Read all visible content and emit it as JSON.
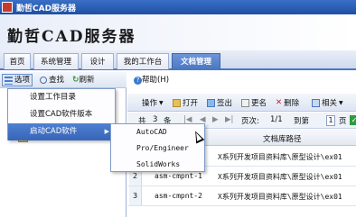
{
  "window": {
    "title": "勤哲CAD服务器"
  },
  "logo": {
    "text": "勤哲CAD服务器"
  },
  "tabs": [
    {
      "label": "首页"
    },
    {
      "label": "系统管理"
    },
    {
      "label": "设计"
    },
    {
      "label": "我的工作台"
    },
    {
      "label": "文档管理"
    }
  ],
  "left_toolbar": {
    "options_label": "选项",
    "find_label": "查找",
    "refresh_label": "刷新",
    "help_label": "帮助(H)"
  },
  "menu": {
    "items": [
      {
        "label": "设置工作目录"
      },
      {
        "label": "设置CAD软件版本"
      },
      {
        "label": "启动CAD软件"
      }
    ],
    "submenu_arrow": "▶"
  },
  "submenu": {
    "items": [
      {
        "label": "AutoCAD"
      },
      {
        "label": "Pro/Engineer"
      },
      {
        "label": "SolidWorks"
      }
    ]
  },
  "right_toolbar": {
    "operate_label": "操作",
    "open_label": "打开",
    "checkout_label": "签出",
    "rename_label": "更名",
    "delete_label": "删除",
    "related_label": "相关"
  },
  "pager": {
    "total_label": "共",
    "total_value": "3",
    "total_unit": "条",
    "pages_label": "页次:",
    "pages_value": "1/1",
    "goto_label": "到第",
    "goto_value": "1",
    "page_unit": "页"
  },
  "grid": {
    "path_header": "文档库路径",
    "rows": [
      {
        "num": "",
        "name": "",
        "path": "X系列开发项目资料库\\原型设计\\ex01"
      },
      {
        "num": "2",
        "name": "asm-cmpnt-1",
        "path": "X系列开发项目资料库\\原型设计\\ex01"
      },
      {
        "num": "3",
        "name": "asm-cmpnt-2",
        "path": "X系列开发项目资料库\\原型设计\\ex01"
      }
    ]
  },
  "colors": {
    "accent": "#4a78c2",
    "menu_highlight": "#3765b8"
  }
}
